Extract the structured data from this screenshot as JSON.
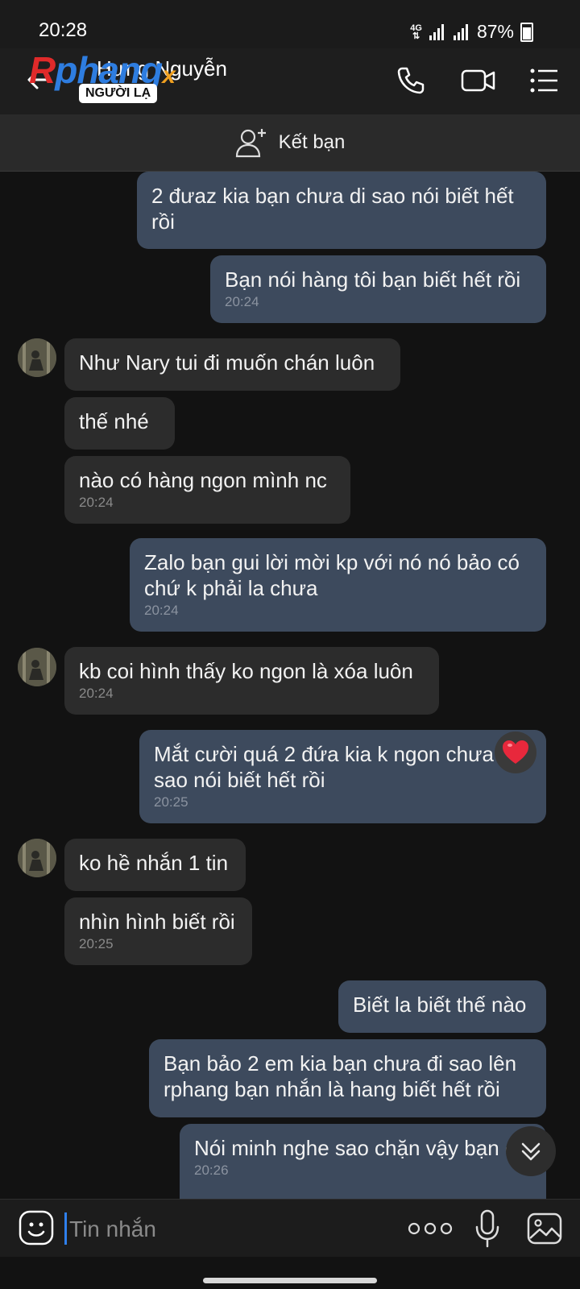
{
  "status_bar": {
    "time": "20:28",
    "network": "4G",
    "battery": "87%"
  },
  "header": {
    "logo_text_r": "R",
    "logo_text_rest": "phang",
    "logo_text_x": "x",
    "contact_name": "Hưng Nguyễn",
    "badge": "NGƯỜI LẠ",
    "icons": [
      "back-arrow-icon",
      "phone-icon",
      "video-call-icon",
      "menu-list-icon"
    ]
  },
  "add_friend": {
    "label": "Kết bạn",
    "icon": "add-user-icon"
  },
  "messages": [
    {
      "dir": "out",
      "text": "2 đưaz kia bạn chưa di sao nói biết hết rồi",
      "time": ""
    },
    {
      "dir": "out",
      "text": "Bạn nói hàng tôi bạn biết hết rồi",
      "time": "20:24"
    },
    {
      "dir": "in",
      "text": "Như Nary tui đi muốn chán luôn",
      "time": ""
    },
    {
      "dir": "in",
      "text": "thế nhé",
      "time": ""
    },
    {
      "dir": "in",
      "text": "nào có hàng ngon mình nc",
      "time": "20:24"
    },
    {
      "dir": "out",
      "text": "Zalo bạn gui lời mời kp với nó nó bảo có chứ k phải la chưa",
      "time": "20:24"
    },
    {
      "dir": "in",
      "text": "kb coi hình thấy ko ngon là xóa luôn",
      "time": "20:24"
    },
    {
      "dir": "out",
      "text": "Mắt cười quá 2 đứa kia k ngon chưa đi sao nói biết hết rồi",
      "time": "20:25",
      "reaction": "heart"
    },
    {
      "dir": "in",
      "text": "ko hề nhắn 1 tin",
      "time": ""
    },
    {
      "dir": "in",
      "text": "nhìn hình biết rồi",
      "time": "20:25"
    },
    {
      "dir": "out",
      "text": "Biết la biết thế nào",
      "time": ""
    },
    {
      "dir": "out",
      "text": "Bạn bảo 2 em kia bạn chưa đi sao lên rphang bạn nhắn là hang biết hết rồi",
      "time": ""
    },
    {
      "dir": "out",
      "text": "Nói minh nghe sao chặn vậy bạn ơi",
      "time": "20:26"
    }
  ],
  "input": {
    "placeholder": "Tin nhắn"
  },
  "colors": {
    "outgoing": "#3d4a5d",
    "incoming": "#2c2c2c",
    "background": "#121212",
    "accent": "#2f80ed"
  }
}
